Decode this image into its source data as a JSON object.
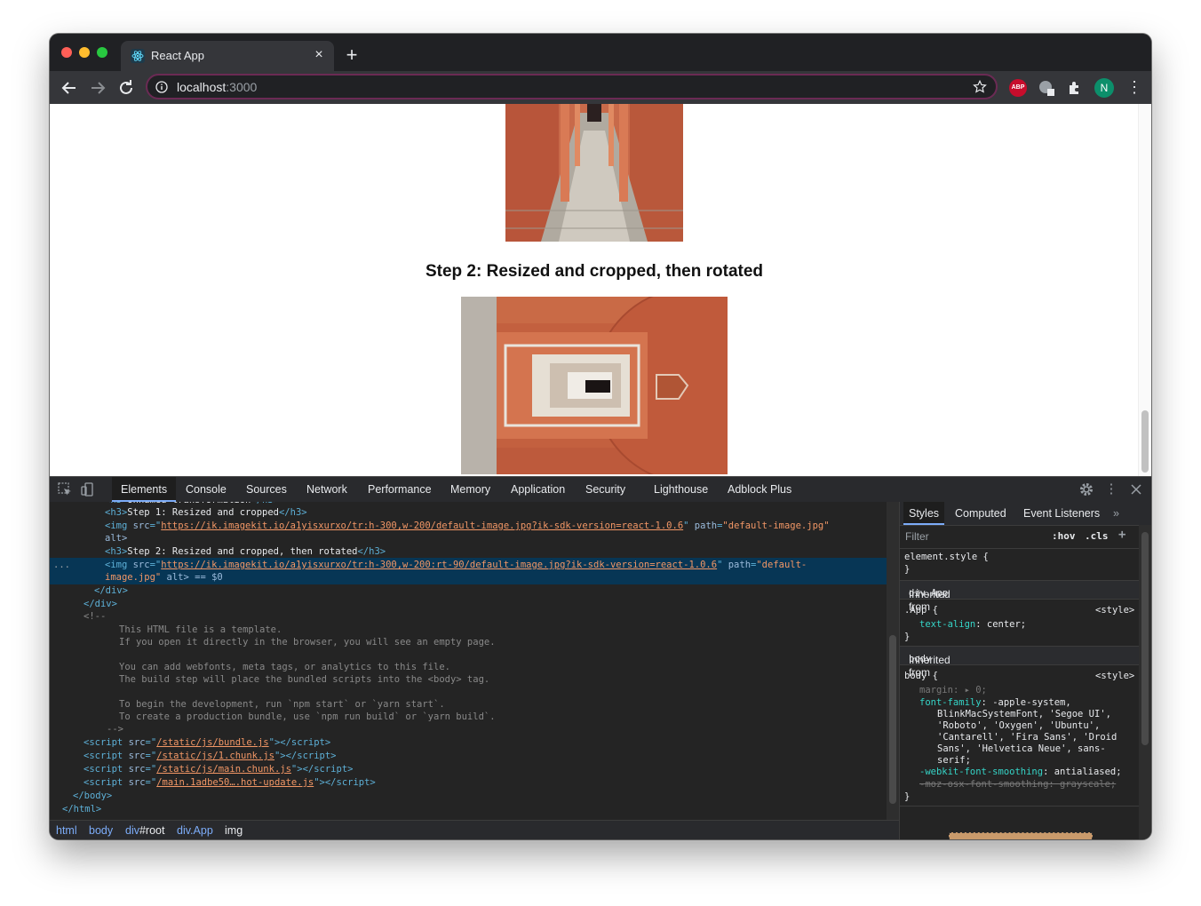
{
  "browser": {
    "tab_title": "React App",
    "new_tab": "+",
    "tab_close": "×",
    "url_host": "localhost",
    "url_port": ":3000",
    "avatar_initial": "N",
    "abp_label": "ABP"
  },
  "page": {
    "heading_step2": "Step 2: Resized and cropped, then rotated"
  },
  "devtools": {
    "tabs": [
      "Elements",
      "Console",
      "Sources",
      "Network",
      "Performance",
      "Memory",
      "Application",
      "Security",
      "Lighthouse",
      "Adblock Plus"
    ],
    "active_tab": "Elements",
    "code": {
      "l1_tag_open": "<h3>",
      "l1_text": "Step 1: Resized and cropped",
      "l1_tag_close": "</h3>",
      "l2_src_url": "https://ik.imagekit.io/a1yisxurxo/tr:h-300,w-200/default-image.jpg?ik-sdk-version=react-1.0.6",
      "l2_path_val": "\"default-image.jpg\"",
      "l3_alt": "alt>",
      "l4_text": "Step 2: Resized and cropped, then rotated",
      "l5_src_url": "https://ik.imagekit.io/a1yisxurxo/tr:h-300,w-200:rt-90/default-image.jpg?ik-sdk-version=react-1.0.6",
      "l5_path_val": "\"default-",
      "l6_path_tail": "image.jpg\"",
      "l6_rest": " alt> == $0",
      "close_div1": "</div>",
      "close_div2": "</div>",
      "comment_open": "<!--",
      "comment_lines": [
        "This HTML file is a template.",
        "If you open it directly in the browser, you will see an empty page.",
        "",
        "You can add webfonts, meta tags, or analytics to this file.",
        "The build step will place the bundled scripts into the <body> tag.",
        "",
        "To begin the development, run `npm start` or `yarn start`.",
        "To create a production bundle, use `npm run build` or `yarn build`."
      ],
      "comment_close": "-->",
      "scripts": [
        "/static/js/bundle.js",
        "/static/js/1.chunk.js",
        "/static/js/main.chunk.js",
        "/main.1adbe50….hot-update.js"
      ],
      "close_body": "</body>",
      "close_html": "</html>",
      "ellipsis": "..."
    },
    "breadcrumbs": [
      "html",
      "body",
      "div",
      "#root",
      "div.App",
      "img"
    ],
    "styles_tabs": [
      "Styles",
      "Computed",
      "Event Listeners"
    ],
    "styles_more": "»",
    "filter_placeholder": "Filter",
    "filter_hov": ":hov",
    "filter_cls": ".cls",
    "filter_add": "+",
    "element_style_open": "element.style {",
    "element_style_close": "}",
    "inherited_app_prefix": "Inherited from ",
    "inherited_app_sel": "div.App",
    "app_rule_open": ".App {",
    "app_source": "<style>",
    "app_prop": "text-align",
    "app_val": "center;",
    "app_rule_close": "}",
    "inherited_body_prefix": "Inherited from ",
    "inherited_body_sel": "body",
    "body_rule_open": "body {",
    "body_source": "<style>",
    "body_margin_prop": "margin",
    "body_margin_val": ": ▸ 0;",
    "body_ff_prop": "font-family",
    "body_ff_val_lines": [
      ": -apple-system,",
      "BlinkMacSystemFont, 'Segoe UI',",
      "'Roboto', 'Oxygen', 'Ubuntu',",
      "'Cantarell', 'Fira Sans', 'Droid",
      "Sans', 'Helvetica Neue', sans-",
      "serif;"
    ],
    "body_wfs_prop": "-webkit-font-smoothing",
    "body_wfs_val": ": antialiased;",
    "body_moz": "-moz-osx-font-smoothing: grayscale;",
    "body_rule_close": "}"
  },
  "colors": {
    "accent_blue": "#7cacf8",
    "selection": "#073655",
    "tag": "#5db0d7",
    "attr_value": "#f29766",
    "css_prop": "#35d4c7"
  }
}
